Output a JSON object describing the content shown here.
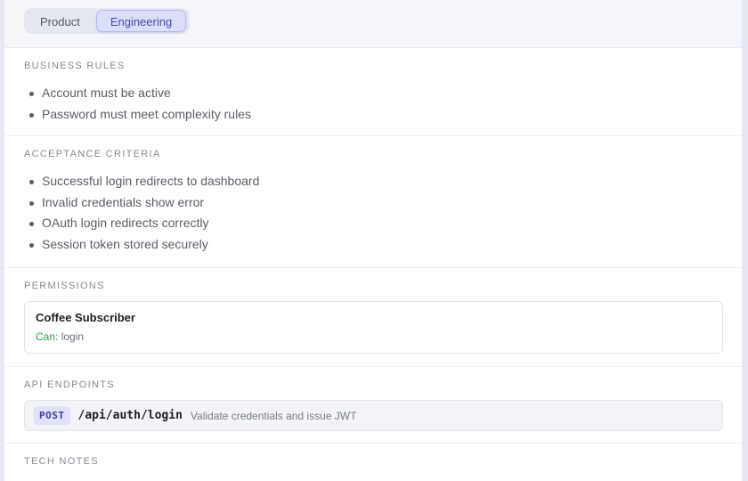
{
  "tabs": [
    {
      "label": "Product",
      "active": false
    },
    {
      "label": "Engineering",
      "active": true
    }
  ],
  "business_rules": {
    "title": "BUSINESS RULES",
    "items": [
      "Account must be active",
      "Password must meet complexity rules"
    ]
  },
  "acceptance": {
    "title": "ACCEPTANCE CRITERIA",
    "items": [
      "Successful login redirects to dashboard",
      "Invalid credentials show error",
      "OAuth login redirects correctly",
      "Session token stored securely"
    ]
  },
  "permissions": {
    "title": "PERMISSIONS",
    "role": "Coffee Subscriber",
    "can_label": "Can:",
    "can_value": "login"
  },
  "api": {
    "title": "API ENDPOINTS",
    "method": "POST",
    "path": "/api/auth/login",
    "description": "Validate credentials and issue JWT"
  },
  "tech_notes": {
    "title": "TECH NOTES"
  },
  "colors": {
    "accent": "#4a4cae",
    "can_green": "#22a043",
    "background": "#e6e8f3"
  }
}
